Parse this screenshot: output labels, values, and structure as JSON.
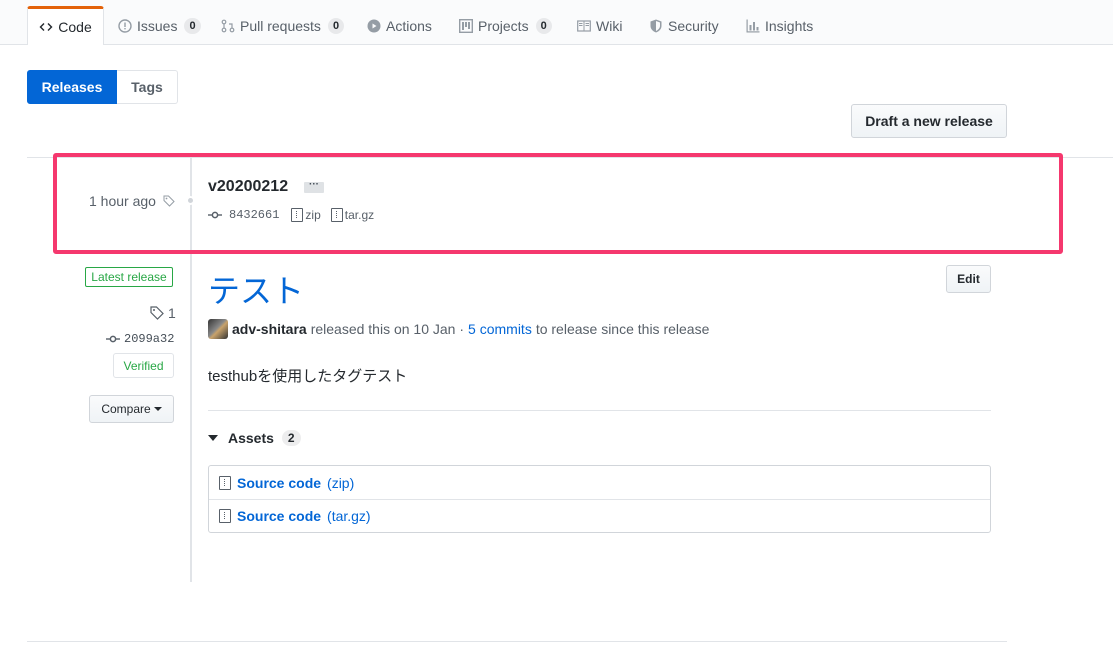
{
  "tabs": [
    {
      "label": "Code",
      "icon": "code-icon"
    },
    {
      "label": "Issues",
      "icon": "issue-icon",
      "count": "0"
    },
    {
      "label": "Pull requests",
      "icon": "pull-request-icon",
      "count": "0"
    },
    {
      "label": "Actions",
      "icon": "play-icon"
    },
    {
      "label": "Projects",
      "icon": "project-icon",
      "count": "0"
    },
    {
      "label": "Wiki",
      "icon": "book-icon"
    },
    {
      "label": "Security",
      "icon": "shield-icon"
    },
    {
      "label": "Insights",
      "icon": "graph-icon"
    }
  ],
  "subnav": {
    "releases": "Releases",
    "tags": "Tags"
  },
  "draft_button": "Draft a new release",
  "tag_row": {
    "time_ago": "1 hour ago",
    "tag_name": "v20200212",
    "ellipsis": "···",
    "commit": "8432661",
    "zip": "zip",
    "targz": "tar.gz"
  },
  "release": {
    "latest_label": "Latest release",
    "tag_count": "1",
    "commit_sha": "2099a32",
    "verified": "Verified",
    "compare": "Compare",
    "title": "テスト",
    "edit": "Edit",
    "author": "adv-shitara",
    "released_text": "released this on 10 Jan ·",
    "commits_link": "5 commits",
    "since_text": "to release since this release",
    "description": "testhubを使用したタグテスト",
    "assets_label": "Assets",
    "assets_count": "2",
    "assets": [
      {
        "name": "Source code",
        "ext": "(zip)"
      },
      {
        "name": "Source code",
        "ext": "(tar.gz)"
      }
    ]
  },
  "colors": {
    "accent": "#0366d6",
    "highlight": "#f5386e",
    "verified": "#28a745",
    "tab_active_border": "#e36209"
  }
}
